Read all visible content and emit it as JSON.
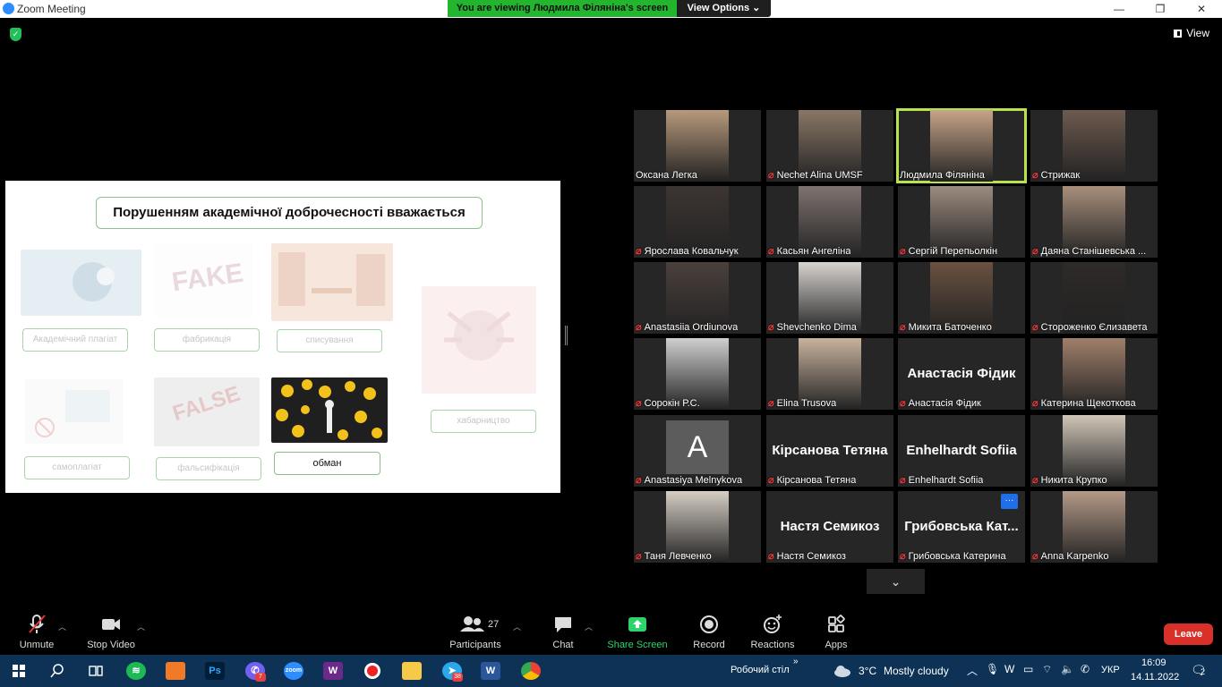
{
  "window": {
    "title": "Zoom Meeting",
    "minimize": "—",
    "restore": "❐",
    "close": "✕"
  },
  "banner": {
    "viewing_text": "You are viewing Людмила Філяніна's screen",
    "view_options": "View Options ⌄"
  },
  "view_button": {
    "label": "View"
  },
  "slide": {
    "title": "Порушенням академічної доброчесності вважається",
    "labels": {
      "plagiat": "Академічний плагіат",
      "fabrikatsiya": "фабрикація",
      "spysuvannya": "списування",
      "habarnytstvo": "хабарництво",
      "samoplagiat": "самоплагіат",
      "falsyfikatsiya": "фальсифікація",
      "obman": "обман"
    },
    "thumb_text": {
      "fake": "FAKE",
      "false": "FALSE"
    }
  },
  "participants": [
    {
      "name": "Оксана Легка",
      "muted": false
    },
    {
      "name": "Nechet Alina UMSF",
      "muted": true
    },
    {
      "name": "Людмила Філяніна",
      "muted": false,
      "speaking": true
    },
    {
      "name": "Стрижак",
      "muted": true
    },
    {
      "name": "Ярослава Ковальчук",
      "muted": true
    },
    {
      "name": "Касьян Ангеліна",
      "muted": true
    },
    {
      "name": "Сергій Перепьолкін",
      "muted": true
    },
    {
      "name": "Даяна Станішевська ...",
      "muted": true
    },
    {
      "name": "Anastasiia Ordiunova",
      "muted": true
    },
    {
      "name": "Shevchenko Dima",
      "muted": true
    },
    {
      "name": "Микита Баточенко",
      "muted": true
    },
    {
      "name": "Стороженко Єлизавета",
      "muted": true
    },
    {
      "name": "Сорокін Р.С.",
      "muted": true
    },
    {
      "name": "Elina Trusova",
      "muted": true
    },
    {
      "name": "Анастасія Фідик",
      "muted": true,
      "video_off_text": "Анастасія Фідик"
    },
    {
      "name": "Катерина Щекоткова",
      "muted": true
    },
    {
      "name": "Anastasiya Melnykova",
      "muted": true,
      "avatar_letter": "A"
    },
    {
      "name": "Кірсанова Тетяна",
      "muted": true,
      "video_off_text": "Кірсанова Тетяна"
    },
    {
      "name": "Enhelhardt Sofiia",
      "muted": true,
      "video_off_text": "Enhelhardt Sofiia"
    },
    {
      "name": "Никита Крупко",
      "muted": true
    },
    {
      "name": "Таня Левченко",
      "muted": true
    },
    {
      "name": "Настя Семикоз",
      "muted": true,
      "video_off_text": "Настя Семикоз"
    },
    {
      "name": "Грибовська Катерина",
      "muted": true,
      "video_off_text": "Грибовська Кат...",
      "more": "···"
    },
    {
      "name": "Anna Karpenko",
      "muted": true
    }
  ],
  "gallery_next": "⌄",
  "toolbar": {
    "unmute": "Unmute",
    "stop_video": "Stop Video",
    "participants": "Participants",
    "participants_count": "27",
    "chat": "Chat",
    "share_screen": "Share Screen",
    "record": "Record",
    "reactions": "Reactions",
    "apps": "Apps",
    "leave": "Leave"
  },
  "taskbar": {
    "desktop_label": "Робочий стіл",
    "weather_temp": "3°C",
    "weather_desc": "Mostly cloudy",
    "lang": "УКР",
    "time": "16:09",
    "date": "14.11.2022",
    "notif_count": "2",
    "viber_badge": "7",
    "telegram_badge": "38"
  },
  "colors": {
    "banner_green": "#24b52e",
    "speaking_outline": "#b9e34a",
    "leave_red": "#d9302a",
    "share_green": "#2fd36b",
    "taskbar": "#0d3256"
  }
}
